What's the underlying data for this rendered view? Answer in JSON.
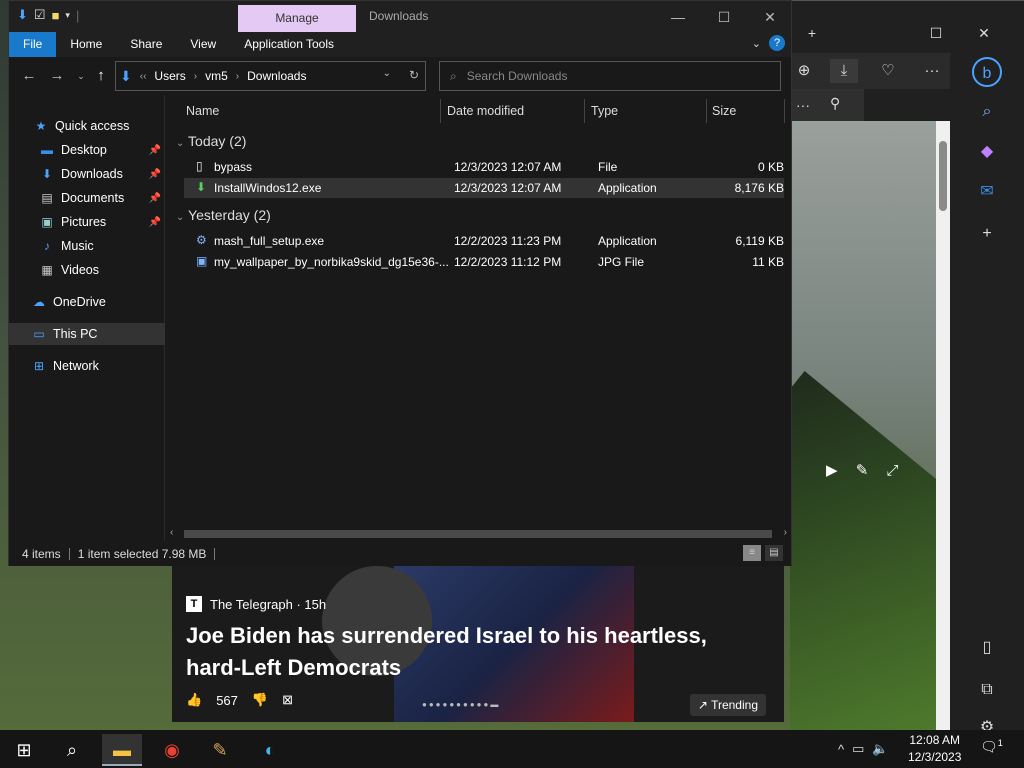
{
  "explorer": {
    "title": "Downloads",
    "context_tab": "Manage",
    "ribbon_tabs": [
      "File",
      "Home",
      "Share",
      "View",
      "Application Tools"
    ],
    "breadcrumb": [
      "Users",
      "vm5",
      "Downloads"
    ],
    "search_placeholder": "Search Downloads",
    "columns": {
      "name": "Name",
      "date": "Date modified",
      "type": "Type",
      "size": "Size"
    },
    "nav": {
      "quick_access": "Quick access",
      "items": [
        "Desktop",
        "Downloads",
        "Documents",
        "Pictures",
        "Music",
        "Videos"
      ],
      "onedrive": "OneDrive",
      "this_pc": "This PC",
      "network": "Network"
    },
    "groups": [
      {
        "label": "Today (2)",
        "files": [
          {
            "name": "bypass",
            "date": "12/3/2023 12:07 AM",
            "type": "File",
            "size": "0 KB",
            "icon": "blank-file-icon"
          },
          {
            "name": "InstallWindos12.exe",
            "date": "12/3/2023 12:07 AM",
            "type": "Application",
            "size": "8,176 KB",
            "icon": "installer-icon"
          }
        ]
      },
      {
        "label": "Yesterday (2)",
        "files": [
          {
            "name": "mash_full_setup.exe",
            "date": "12/2/2023 11:23 PM",
            "type": "Application",
            "size": "6,119 KB",
            "icon": "setup-icon"
          },
          {
            "name": "my_wallpaper_by_norbika9skid_dg15e36-...",
            "date": "12/2/2023 11:12 PM",
            "type": "JPG File",
            "size": "11 KB",
            "icon": "image-file-icon"
          }
        ]
      }
    ],
    "status": {
      "count": "4 items",
      "selected": "1 item selected  7.98 MB"
    }
  },
  "news": {
    "source": "The Telegraph · 15h",
    "headline": "Joe Biden has surrendered Israel to his heartless, hard-Left Democrats",
    "likes": "567",
    "trending": "Trending"
  },
  "taskbar": {
    "time": "12:08 AM",
    "date": "12/3/2023",
    "notifications": "1"
  },
  "colors": {
    "accent": "#1979ca",
    "manage_tab": "#e5c9f5",
    "window_bg": "#191919"
  }
}
